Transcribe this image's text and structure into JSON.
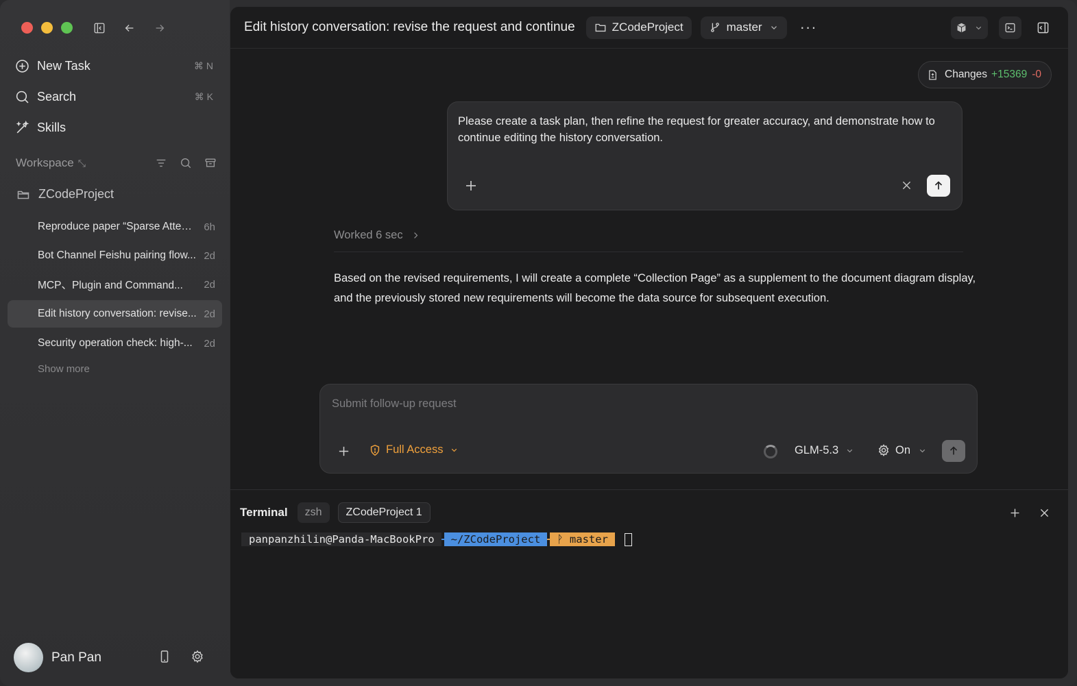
{
  "sidebar": {
    "nav": [
      {
        "label": "New Task",
        "shortcut": "⌘ N",
        "icon": "plus-circle-icon"
      },
      {
        "label": "Search",
        "shortcut": "⌘ K",
        "icon": "search-icon"
      },
      {
        "label": "Skills",
        "shortcut": "",
        "icon": "magic-wand-icon"
      }
    ],
    "workspace_title": "Workspace",
    "project_name": "ZCodeProject",
    "threads": [
      {
        "title": "Reproduce paper “Sparse Attenti...",
        "age": "6h"
      },
      {
        "title": "Bot Channel Feishu pairing flow...",
        "age": "2d"
      },
      {
        "title": "MCP、Plugin and Command...",
        "age": "2d"
      },
      {
        "title": "Edit history conversation: revise...",
        "age": "2d"
      },
      {
        "title": "Security operation check: high-...",
        "age": "2d"
      }
    ],
    "show_more": "Show more",
    "user_name": "Pan Pan"
  },
  "header": {
    "title": "Edit history conversation: revise the request and continue",
    "project": "ZCodeProject",
    "branch": "master",
    "more": "···"
  },
  "changes": {
    "label": "Changes",
    "added": "+15369",
    "removed": "-0"
  },
  "edit_box": {
    "text": "Please create a task plan, then refine the request for greater accuracy, and demonstrate how to continue editing the history conversation."
  },
  "worked": "Worked 6 sec",
  "reply": "Based on the revised requirements, I will create a complete “Collection Page” as a supplement to the document diagram display, and the previously stored new requirements will become the data source for subsequent execution.",
  "followup": {
    "placeholder": "Submit follow-up request",
    "access": "Full Access",
    "model": "GLM-5.3",
    "thinking": "On"
  },
  "terminal": {
    "title": "Terminal",
    "tabs": [
      "zsh",
      "ZCodeProject 1"
    ],
    "prompt_user": "panpanzhilin@Panda-MacBookPro",
    "prompt_sep1": "",
    "prompt_dir": " ~/ZCodeProject ",
    "prompt_sep2": "",
    "prompt_branch": "ᚹ master",
    "prompt_end": ""
  },
  "colors": {
    "accent_orange": "#f0a13c",
    "added_green": "#5dbf6e",
    "removed_red": "#e36c63",
    "terminal_blue": "#4b8fe0"
  }
}
